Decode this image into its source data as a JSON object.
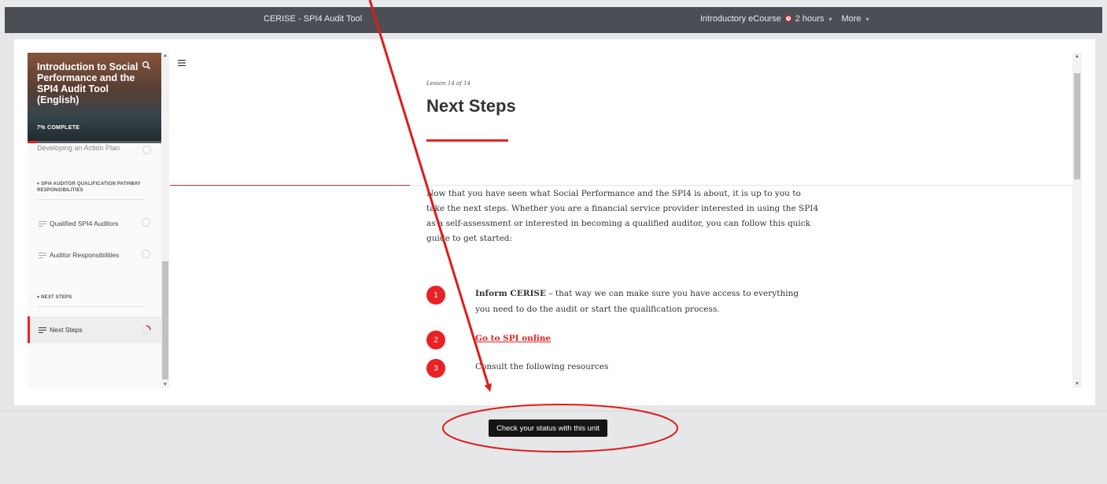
{
  "topbar": {
    "app_title": "CERISE - SPI4 Audit Tool",
    "course_label": "Introductory eCourse",
    "duration": "2 hours",
    "more_label": "More"
  },
  "sidebar": {
    "course_title": "Introduction to Social Performance and the SPI4 Audit Tool (English)",
    "progress_text": "7% COMPLETE",
    "progress_percent": 7,
    "cut_item": "Developing an Action Plan",
    "sections": [
      {
        "title": "SPI4 AUDITOR QUALIFICATION PATHWAY RESPONSIBILITIES",
        "lessons": [
          {
            "label": "Qualified SPI4 Auditors"
          },
          {
            "label": "Auditor Responsibilities"
          }
        ]
      },
      {
        "title": "NEXT STEPS",
        "lessons": [
          {
            "label": "Next Steps",
            "active": true
          }
        ]
      }
    ]
  },
  "lesson": {
    "number": "Lesson 14 of 14",
    "title": "Next Steps",
    "intro": "Now that you have seen what Social Performance and the SPI4 is about, it is up to you to take the next steps. Whether you are a financial service provider interested in using the SPI4 as a self-assessment or interested in becoming a qualified auditor, you can follow this quick guide to get started:",
    "steps": [
      {
        "num": "1",
        "bold": "Inform CERISE",
        "rest": " – that way we can make sure you have access to everything you need to do the audit or start the qualification process."
      },
      {
        "num": "2",
        "link": "Go to SPI online"
      },
      {
        "num": "3",
        "text": "Consult the following resources"
      }
    ]
  },
  "footer": {
    "status_button": "Check your status with this unit"
  },
  "colors": {
    "accent": "#e82224",
    "topbar": "#4b4e55",
    "button": "#151515"
  }
}
